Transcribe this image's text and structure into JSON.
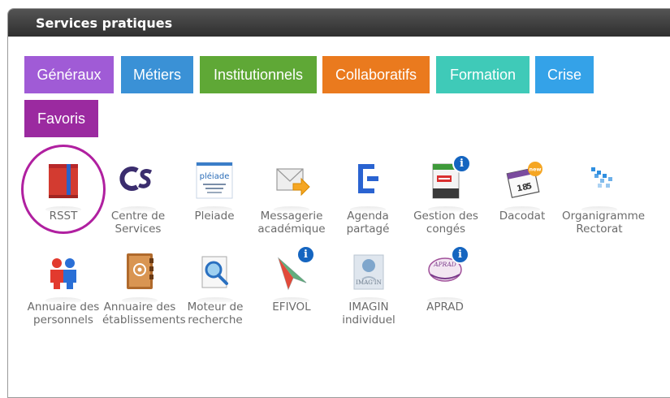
{
  "panel": {
    "title": "Services pratiques"
  },
  "tabs": [
    {
      "label": "Généraux",
      "color": "#a05bd6"
    },
    {
      "label": "Métiers",
      "color": "#3a91d6"
    },
    {
      "label": "Institutionnels",
      "color": "#5fa836"
    },
    {
      "label": "Collaboratifs",
      "color": "#ea7a1e"
    },
    {
      "label": "Formation",
      "color": "#3fcab8"
    },
    {
      "label": "Crise",
      "color": "#34a2e8"
    },
    {
      "label": "Favoris",
      "color": "#9b2aa0"
    }
  ],
  "services": [
    {
      "label": "RSST",
      "icon": "book-icon",
      "info": false
    },
    {
      "label": "Centre de\nServices",
      "icon": "cs-logo-icon",
      "info": false
    },
    {
      "label": "Pleiade",
      "icon": "pleiade-logo-icon",
      "logo_text": "pléiade",
      "info": false
    },
    {
      "label": "Messagerie\nacadémique",
      "icon": "mail-icon",
      "info": false
    },
    {
      "label": "Agenda\npartagé",
      "icon": "agenda-icon",
      "info": false
    },
    {
      "label": "Gestion des\ncongés",
      "icon": "conges-icon",
      "info": true
    },
    {
      "label": "Dacodat",
      "icon": "calendar-icon",
      "badge": "new",
      "info": false
    },
    {
      "label": "Organigramme\nRectorat",
      "icon": "organigramme-icon",
      "info": false
    },
    {
      "label": "Annuaire des\npersonnels",
      "icon": "people-icon",
      "info": false
    },
    {
      "label": "Annuaire des\nétablissements",
      "icon": "address-book-icon",
      "info": false
    },
    {
      "label": "Moteur de\nrecherche",
      "icon": "search-icon",
      "info": false
    },
    {
      "label": "EFIVOL",
      "icon": "paper-plane-icon",
      "info": true
    },
    {
      "label": "IMAGIN\nindividuel",
      "icon": "imagin-icon",
      "logo_text": "IMAG'IN",
      "info": false
    },
    {
      "label": "APRAD",
      "icon": "aprad-icon",
      "logo_text": "APRAD",
      "info": true
    }
  ],
  "info_glyph": "i"
}
